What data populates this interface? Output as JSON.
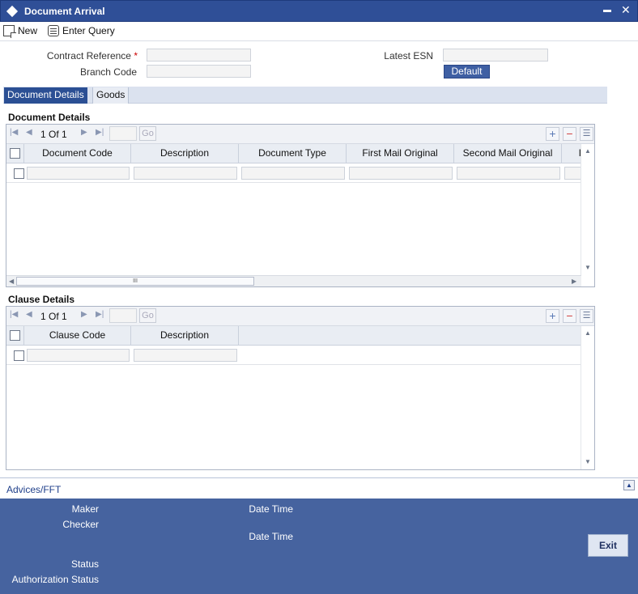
{
  "window": {
    "title": "Document Arrival",
    "minimize": "▬",
    "close": "✕"
  },
  "toolbar": {
    "new_label": "New",
    "enter_query_label": "Enter Query"
  },
  "header": {
    "contract_reference_label": "Contract Reference",
    "required_mark": "*",
    "branch_code_label": "Branch Code",
    "latest_esn_label": "Latest ESN",
    "default_button": "Default",
    "contract_reference_value": "",
    "branch_code_value": "",
    "latest_esn_value": ""
  },
  "tabs": [
    {
      "label": "Document Details"
    },
    {
      "label": "Goods"
    }
  ],
  "document_details": {
    "title": "Document Details",
    "pager": {
      "current": "1",
      "of_label": "Of",
      "total": "1",
      "go": "Go"
    },
    "columns": [
      "Document Code",
      "Description",
      "Document Type",
      "First Mail Original",
      "Second Mail Original",
      "I"
    ],
    "scroll_grip": "III"
  },
  "clause_details": {
    "title": "Clause Details",
    "pager": {
      "current": "1",
      "of_label": "Of",
      "total": "1",
      "go": "Go"
    },
    "columns": [
      "Clause Code",
      "Description"
    ]
  },
  "advices": {
    "link": "Advices/FFT"
  },
  "footer": {
    "maker_label": "Maker",
    "checker_label": "Checker",
    "date_time_label_1": "Date Time",
    "date_time_label_2": "Date Time",
    "status_label": "Status",
    "authorization_status_label": "Authorization Status",
    "exit_button": "Exit"
  }
}
